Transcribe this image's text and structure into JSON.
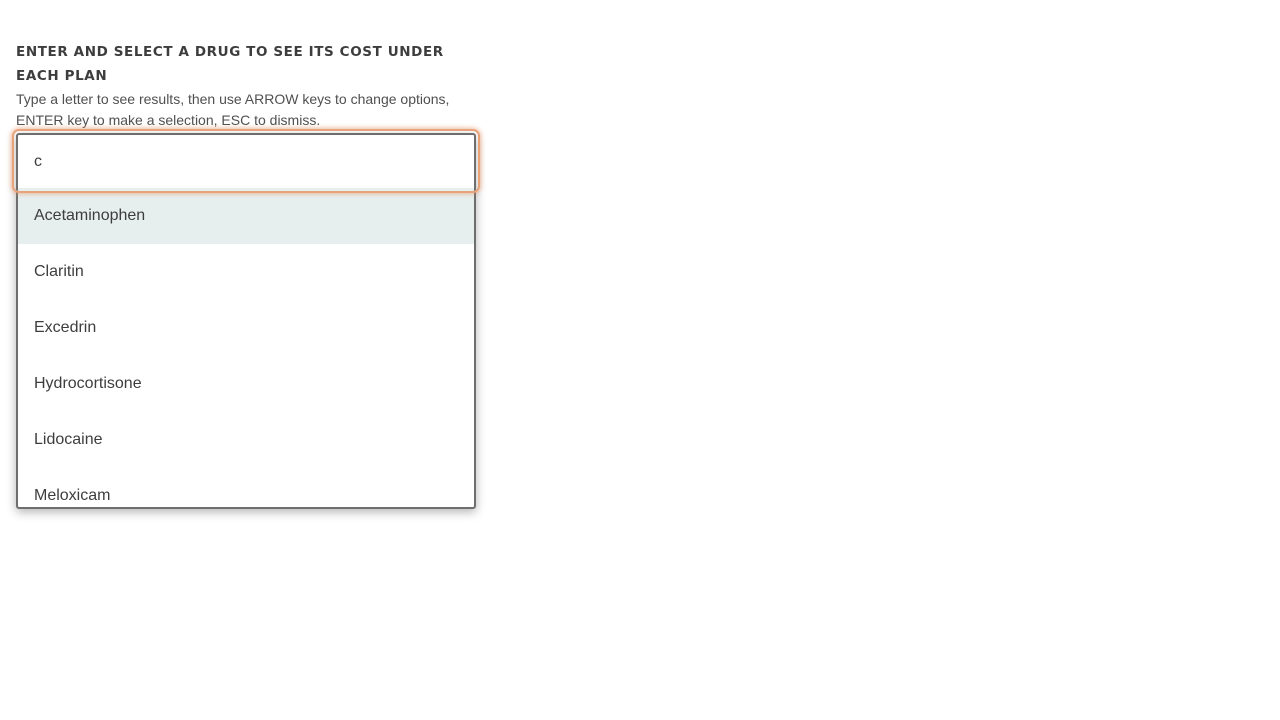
{
  "drug_search": {
    "heading": "ENTER AND SELECT A DRUG TO SEE ITS COST UNDER EACH PLAN",
    "instructions": "Type a letter to see results, then use ARROW keys to change options, ENTER key to make a selection, ESC to dismiss.",
    "input_value": "c",
    "options": [
      {
        "label": "Acetaminophen",
        "highlighted": true
      },
      {
        "label": "Claritin",
        "highlighted": false
      },
      {
        "label": "Excedrin",
        "highlighted": false
      },
      {
        "label": "Hydrocortisone",
        "highlighted": false
      },
      {
        "label": "Lidocaine",
        "highlighted": false
      },
      {
        "label": "Meloxicam",
        "highlighted": false
      }
    ]
  },
  "colors": {
    "focus_ring": "#e8a37a",
    "highlight_bg": "#e6efee",
    "text": "#3d3d3d"
  }
}
